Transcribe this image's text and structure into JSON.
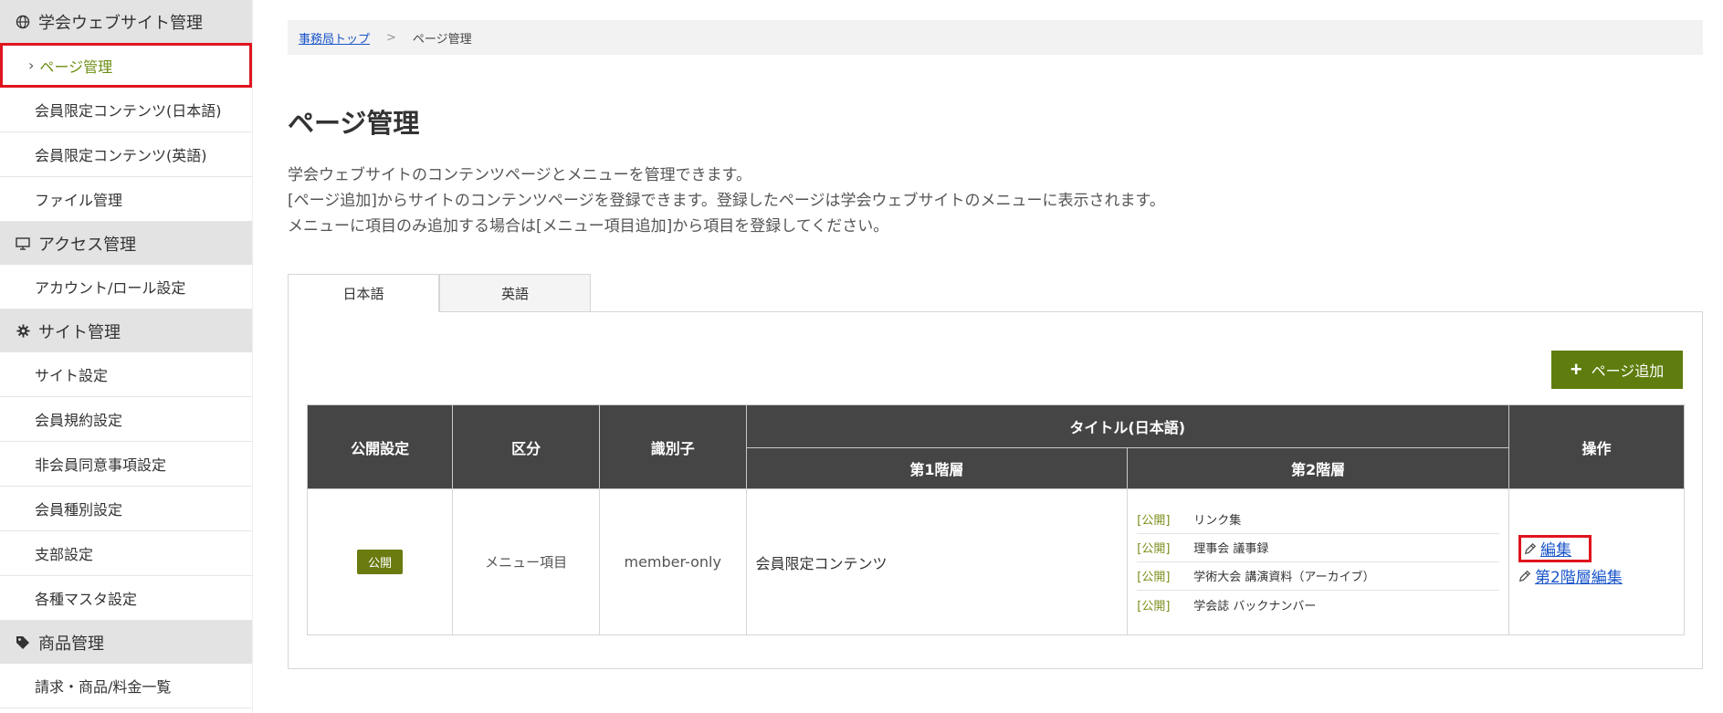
{
  "sidebar": {
    "cat1": "学会ウェブサイト管理",
    "cat1_items": [
      "ページ管理",
      "会員限定コンテンツ(日本語)",
      "会員限定コンテンツ(英語)",
      "ファイル管理"
    ],
    "cat2": "アクセス管理",
    "cat2_items": [
      "アカウント/ロール設定"
    ],
    "cat3": "サイト管理",
    "cat3_items": [
      "サイト設定",
      "会員規約設定",
      "非会員同意事項設定",
      "会員種別設定",
      "支部設定",
      "各種マスタ設定"
    ],
    "cat4": "商品管理",
    "cat4_items": [
      "請求・商品/料金一覧"
    ]
  },
  "breadcrumb": {
    "home": "事務局トップ",
    "sep": ">",
    "current": "ページ管理"
  },
  "page": {
    "title": "ページ管理",
    "desc": [
      "学会ウェブサイトのコンテンツページとメニューを管理できます。",
      "[ページ追加]からサイトのコンテンツページを登録できます。登録したページは学会ウェブサイトのメニューに表示されます。",
      "メニューに項目のみ追加する場合は[メニュー項目追加]から項目を登録してください。"
    ]
  },
  "tabs": [
    "日本語",
    "英語"
  ],
  "add_button": "ページ追加",
  "table": {
    "headers": {
      "publish": "公開設定",
      "category": "区分",
      "identifier": "識別子",
      "title": "タイトル(日本語)",
      "level1": "第1階層",
      "level2": "第2階層",
      "actions": "操作"
    },
    "row": {
      "status": "公開",
      "category": "メニュー項目",
      "identifier": "member-only",
      "level1": "会員限定コンテンツ",
      "level2": [
        {
          "status": "[公開]",
          "title": "リンク集"
        },
        {
          "status": "[公開]",
          "title": "理事会 議事録"
        },
        {
          "status": "[公開]",
          "title": "学術大会 講演資料（アーカイブ）"
        },
        {
          "status": "[公開]",
          "title": "学会誌 バックナンバー"
        }
      ],
      "edit": "編集",
      "edit_level2": "第2階層編集"
    }
  }
}
